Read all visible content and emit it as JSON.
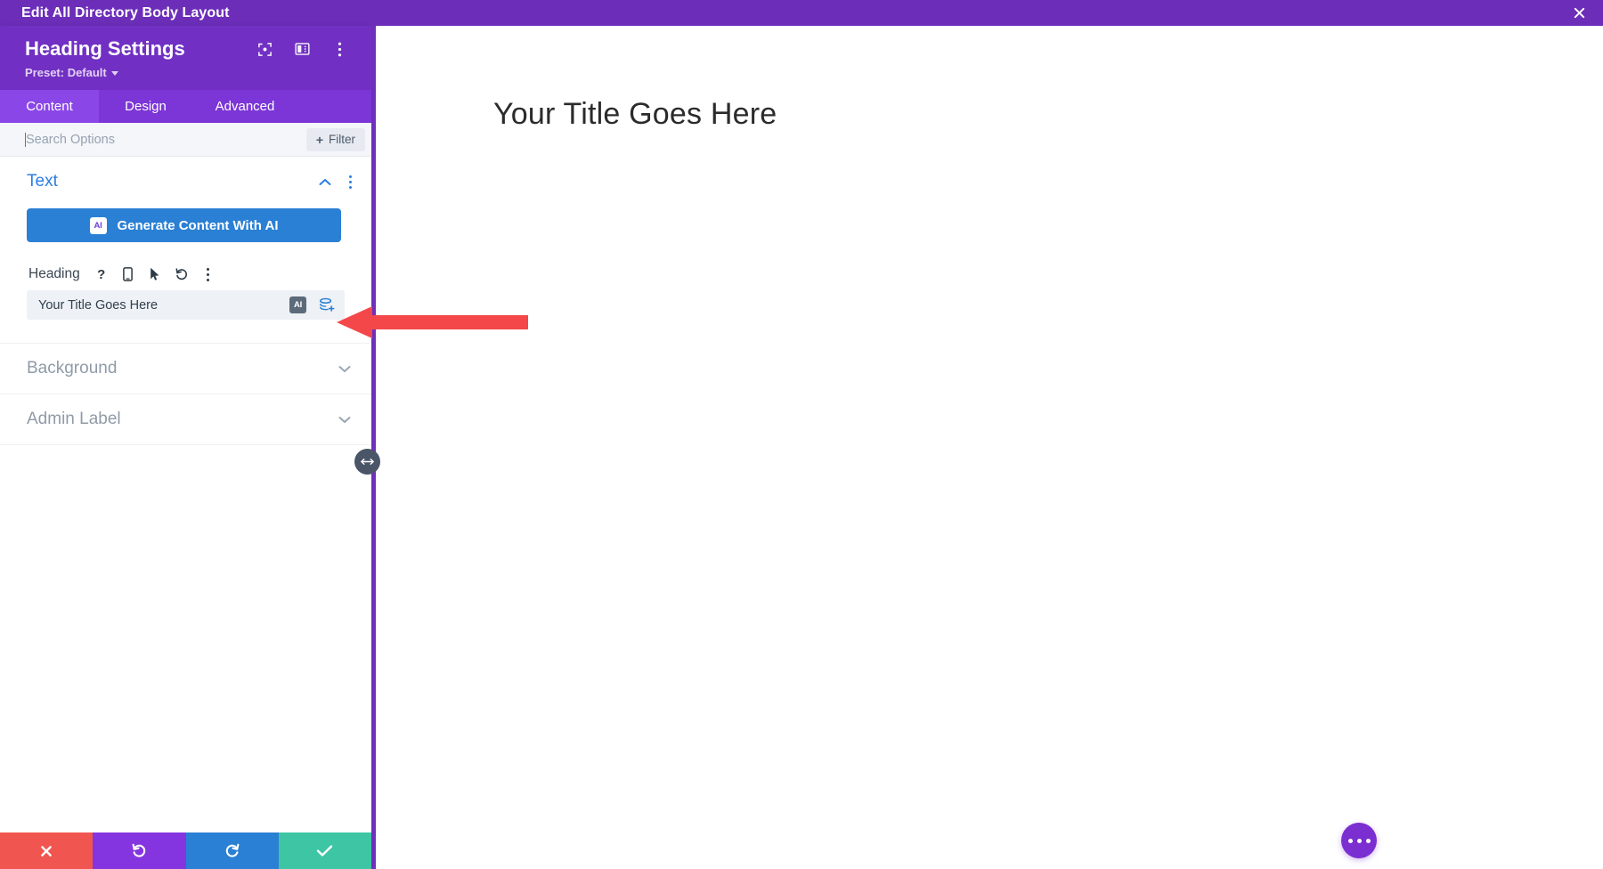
{
  "topbar": {
    "title": "Edit All Directory Body Layout",
    "close_icon": "close-icon"
  },
  "panel": {
    "title": "Heading Settings",
    "preset_label": "Preset: Default",
    "header_icons": [
      {
        "name": "focus-target-icon"
      },
      {
        "name": "panel-layout-icon"
      },
      {
        "name": "more-options-icon"
      }
    ],
    "tabs": [
      {
        "label": "Content",
        "active": true
      },
      {
        "label": "Design",
        "active": false
      },
      {
        "label": "Advanced",
        "active": false
      }
    ],
    "search": {
      "placeholder": "Search Options",
      "value": ""
    },
    "filter_button": {
      "label": "Filter",
      "plus": "+"
    },
    "sections": [
      {
        "title": "Text",
        "state": "open",
        "chevron": "chevron-up-icon"
      },
      {
        "title": "Background",
        "state": "closed",
        "chevron": "chevron-down-icon"
      },
      {
        "title": "Admin Label",
        "state": "closed",
        "chevron": "chevron-down-icon"
      }
    ],
    "ai_button": {
      "label": "Generate Content With AI",
      "badge": "AI"
    },
    "heading_field": {
      "label": "Heading",
      "value": "Your Title Goes Here",
      "icons": [
        {
          "name": "help-icon",
          "glyph": "?"
        },
        {
          "name": "responsive-mobile-icon"
        },
        {
          "name": "hover-cursor-icon"
        },
        {
          "name": "reset-undo-icon"
        },
        {
          "name": "field-options-icon"
        }
      ],
      "input_ai_badge": "AI",
      "dynamic_content_icon": "dynamic-content-layers-add-icon"
    },
    "resize_handle": "panel-resize-handle",
    "actions": [
      {
        "name": "cancel-button",
        "icon": "close-icon",
        "color": "#f0564f"
      },
      {
        "name": "undo-button",
        "icon": "undo-icon",
        "color": "#8435e0"
      },
      {
        "name": "redo-button",
        "icon": "redo-icon",
        "color": "#2a80d4"
      },
      {
        "name": "save-button",
        "icon": "check-icon",
        "color": "#3ec6a4"
      }
    ]
  },
  "canvas": {
    "heading_text": "Your Title Goes Here",
    "fab": "page-settings-fab"
  },
  "annotation": {
    "arrow": "red-pointer-arrow",
    "color": "#f4474a"
  },
  "colors": {
    "topbar_purple": "#6c2eb9",
    "panel_purple": "#7130c3",
    "tab_purple": "#7c35d6",
    "tab_active_purple": "#8b46e8",
    "accent_blue": "#2a80d4",
    "muted_gray": "#8f9ba8"
  }
}
